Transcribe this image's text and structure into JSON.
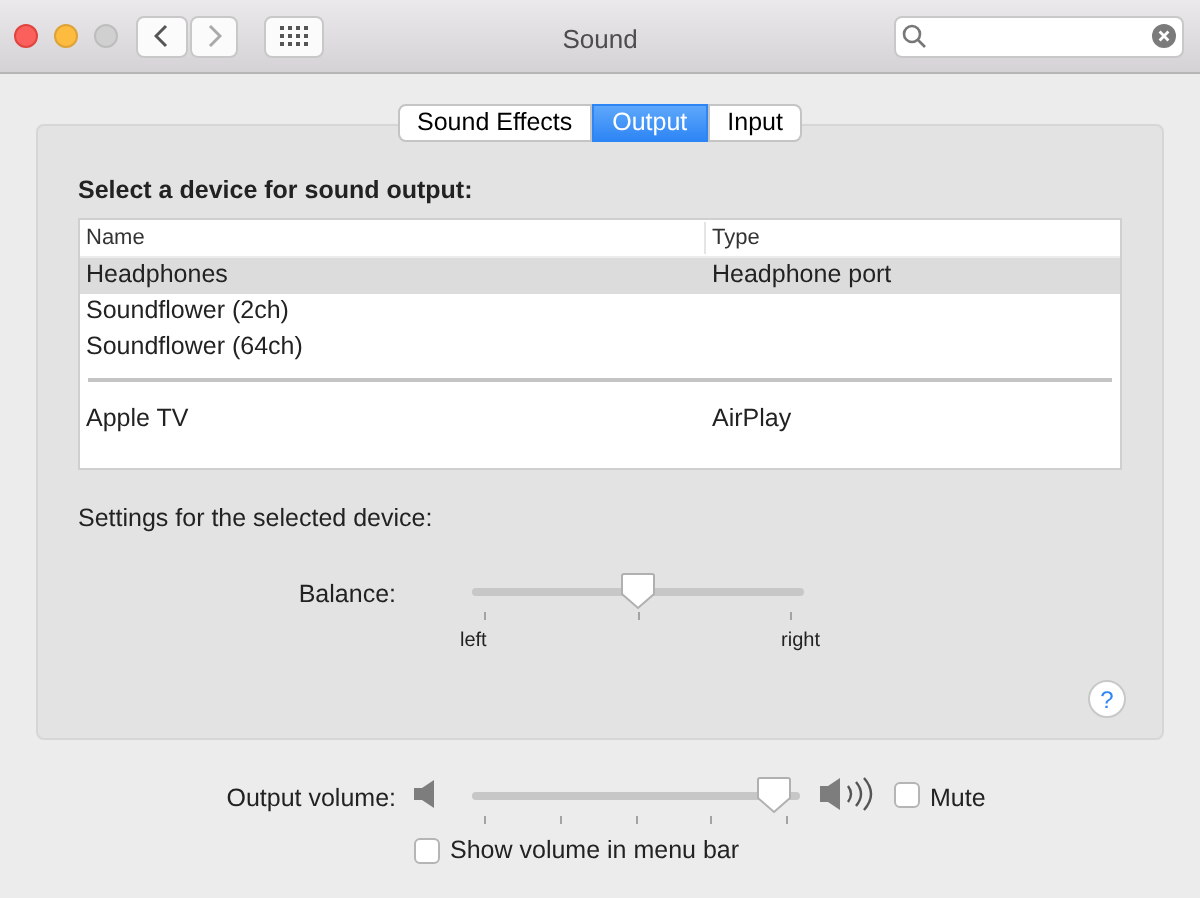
{
  "window": {
    "title": "Sound"
  },
  "tabs": [
    {
      "label": "Sound Effects",
      "selected": false
    },
    {
      "label": "Output",
      "selected": true
    },
    {
      "label": "Input",
      "selected": false
    }
  ],
  "device_list": {
    "heading": "Select a device for sound output:",
    "columns": [
      "Name",
      "Type"
    ],
    "groups": [
      {
        "devices": [
          {
            "name": "Headphones",
            "type": "Headphone port",
            "selected": true
          },
          {
            "name": "Soundflower (2ch)",
            "selected": false
          },
          {
            "name": "Soundflower (64ch)",
            "selected": false
          }
        ]
      },
      {
        "devices": [
          {
            "name": "Apple TV",
            "type": "AirPlay",
            "selected": false
          }
        ]
      }
    ]
  },
  "settings": {
    "heading": "Settings for the selected device:",
    "balance": {
      "label": "Balance:",
      "level": 0.5,
      "min_label": "left",
      "max_label": "right"
    },
    "help": "?"
  },
  "output_volume": {
    "label": "Output volume:",
    "level": 0.97,
    "mute": {
      "label": "Mute",
      "checked": false
    }
  },
  "show_volume_in_menu_bar": {
    "label": "Show volume in menu bar",
    "checked": false
  }
}
